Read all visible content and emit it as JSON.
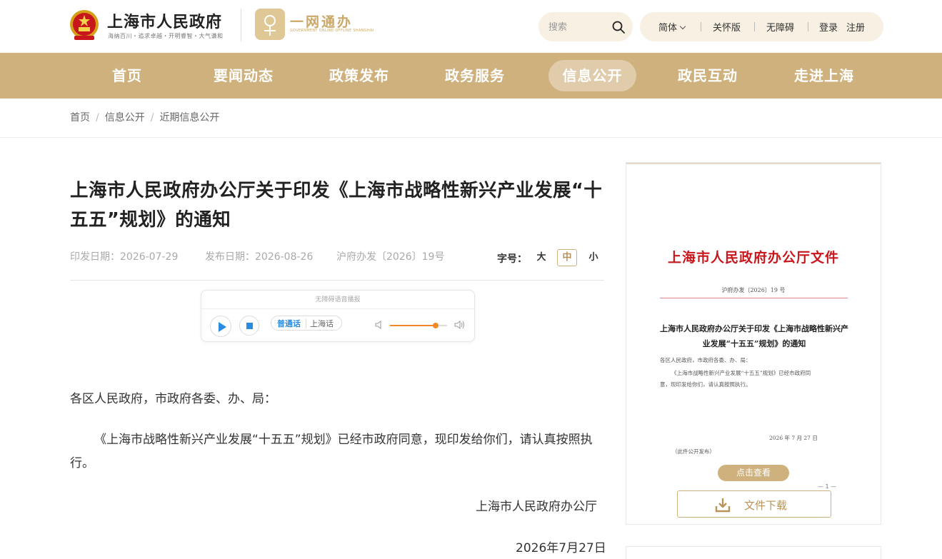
{
  "header": {
    "site_title": "上海市人民政府",
    "site_slogan": "海纳百川・追求卓越・开明睿智・大气谦和",
    "ywtb_text": "一网通办",
    "ywtb_sub": "GOVERNMENT ONLINE-OFFLINE SHANGHAI",
    "search_placeholder": "搜索",
    "util": {
      "lang": "简体",
      "care": "关怀版",
      "accessible": "无障碍",
      "login": "登录",
      "register": "注册"
    }
  },
  "nav": {
    "items": [
      {
        "label": "首页"
      },
      {
        "label": "要闻动态"
      },
      {
        "label": "政策发布"
      },
      {
        "label": "政务服务"
      },
      {
        "label": "信息公开"
      },
      {
        "label": "政民互动"
      },
      {
        "label": "走进上海"
      }
    ],
    "active": "信息公开",
    "bar_color": "#cfb17e"
  },
  "breadcrumb": [
    "首页",
    "信息公开",
    "近期信息公开"
  ],
  "article": {
    "title": "上海市人民政府办公厅关于印发《上海市战略性新兴产业发展“十五五”规划》的通知",
    "print_date": "印发日期：2026-07-29",
    "publish_date": "发布日期：2026-08-26",
    "doc_number": "沪府办发〔2026〕19号",
    "fontsize_label": "字号：",
    "fontsize_options": [
      "大",
      "中",
      "小"
    ],
    "fontsize_selected": "中",
    "player": {
      "header": "无障碍语音播报",
      "lang_active": "普通话",
      "lang_other": "上海话",
      "volume": 0.8
    },
    "salutation": "各区人民政府，市政府各委、办、局：",
    "paragraph": "《上海市战略性新兴产业发展“十五五”规划》已经市政府同意，现印发给你们，请认真按照执行。",
    "signature": "上海市人民政府办公厅",
    "sign_date": "2026年7月27日"
  },
  "doc_preview": {
    "red_title": "上海市人民政府办公厅文件",
    "number": "沪府办发〔2026〕19 号",
    "title": "上海市人民政府办公厅关于印发《上海市战略性新兴产业发展“十五五”规划》的通知",
    "line1": "各区人民政府，市政府各委、办、局：",
    "line2": "《上海市战略性新兴产业发展“十五五”规划》已经市政府同",
    "line3": "意，现印发给你们，请认真按照执行。",
    "date": "2026 年 7 月 27 日",
    "note": "（此件公开发布）",
    "view_button": "点击查看",
    "page": "— 1 —",
    "download_label": "文件下载"
  },
  "colors": {
    "accent_gold": "#cfb17e",
    "header_pill_bg": "#f7f0e3",
    "player_blue": "#2a8ce0",
    "volume_orange": "#f08a24",
    "doc_red": "#c8161d"
  }
}
